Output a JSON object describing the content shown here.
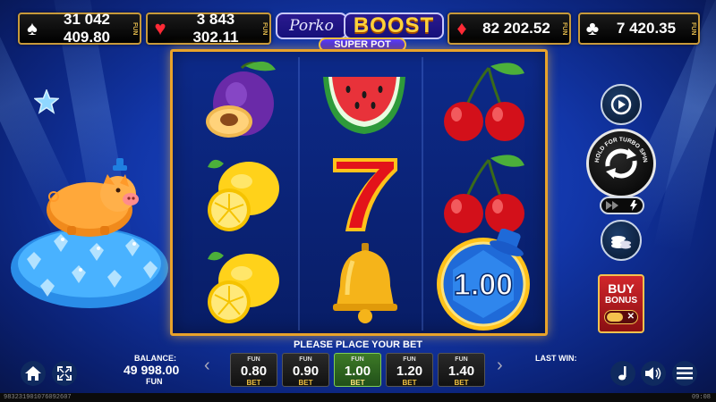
{
  "jackpots": [
    {
      "suit": "♠",
      "suit_color": "#ffffff",
      "value": "31 042 409.80",
      "tag": "FUN"
    },
    {
      "suit": "♥",
      "suit_color": "#ff2a36",
      "value": "3 843 302.11",
      "tag": "FUN"
    },
    {
      "suit": "♦",
      "suit_color": "#ff2a36",
      "value": "82 202.52",
      "tag": "FUN"
    },
    {
      "suit": "♣",
      "suit_color": "#ffffff",
      "value": "7 420.35",
      "tag": "FUN"
    }
  ],
  "logo": {
    "porko": "Porko",
    "boost": "BOOST",
    "superpot": "SUPER POT"
  },
  "reels": [
    [
      "plum",
      "lemon",
      "lemon"
    ],
    [
      "watermelon",
      "seven",
      "bell"
    ],
    [
      "cherries",
      "cherries",
      "coin"
    ]
  ],
  "coin_value": "1.00",
  "controls": {
    "turbo_text": "HOLD FOR TURBO SPIN",
    "buy_label": "BUY",
    "bonus_label": "BONUS"
  },
  "bottom": {
    "prompt": "PLEASE PLACE YOUR BET",
    "balance_label": "BALANCE:",
    "balance_value": "49 998.00",
    "balance_currency": "FUN",
    "last_win_label": "LAST WIN:",
    "bets": [
      {
        "top": "FUN",
        "value": "0.80",
        "bottom": "BET",
        "active": false
      },
      {
        "top": "FUN",
        "value": "0.90",
        "bottom": "BET",
        "active": false
      },
      {
        "top": "FUN",
        "value": "1.00",
        "bottom": "BET",
        "active": true
      },
      {
        "top": "FUN",
        "value": "1.20",
        "bottom": "BET",
        "active": false
      },
      {
        "top": "FUN",
        "value": "1.40",
        "bottom": "BET",
        "active": false
      }
    ],
    "bet_prev": "‹",
    "bet_next": "›"
  },
  "footer": {
    "session_id": "98323190107609260​7",
    "time": "09:08"
  },
  "colors": {
    "frame": "#e9a32a",
    "bg": "#1236a8",
    "active_bet": "#3d7a26"
  }
}
